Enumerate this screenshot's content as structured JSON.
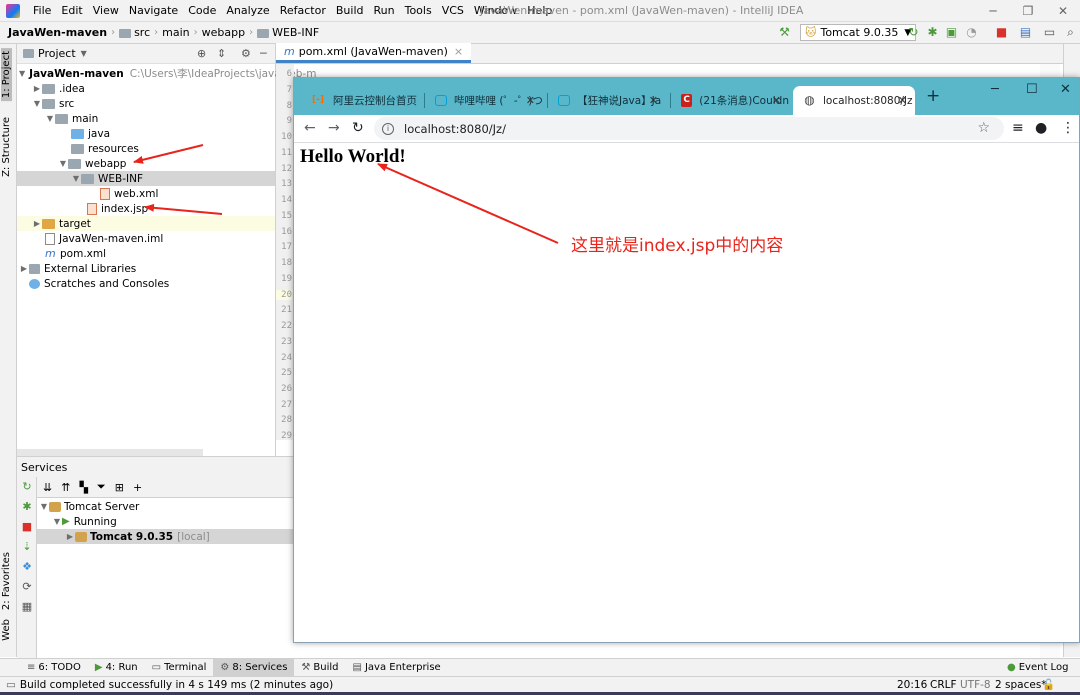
{
  "window": {
    "title": "JavaWen-maven - pom.xml (JavaWen-maven) - IntelliJ IDEA",
    "menu": [
      "File",
      "Edit",
      "View",
      "Navigate",
      "Code",
      "Analyze",
      "Refactor",
      "Build",
      "Run",
      "Tools",
      "VCS",
      "Window",
      "Help"
    ]
  },
  "breadcrumbs": [
    "JavaWen-maven",
    "src",
    "main",
    "webapp",
    "WEB-INF"
  ],
  "run_config": "Tomcat 9.0.35",
  "project_panel": {
    "title": "Project",
    "tree": [
      {
        "label": "JavaWen-maven",
        "extra": "C:\\Users\\李\\IdeaProjects\\javaweb-m",
        "icon": "folder",
        "level": 0
      },
      {
        "label": ".idea",
        "icon": "folder",
        "level": 1
      },
      {
        "label": "src",
        "icon": "folder",
        "level": 1
      },
      {
        "label": "main",
        "icon": "folder",
        "level": 2
      },
      {
        "label": "java",
        "icon": "folder-blue",
        "level": 3
      },
      {
        "label": "resources",
        "icon": "folder",
        "level": 3
      },
      {
        "label": "webapp",
        "icon": "folder",
        "level": 3
      },
      {
        "label": "WEB-INF",
        "icon": "folder",
        "level": 4
      },
      {
        "label": "web.xml",
        "icon": "xml-file",
        "level": 5
      },
      {
        "label": "index.jsp",
        "icon": "jsp-file",
        "level": 4
      },
      {
        "label": "target",
        "icon": "folder-orange",
        "level": 1
      },
      {
        "label": "JavaWen-maven.iml",
        "icon": "iml-file",
        "level": 1
      },
      {
        "label": "pom.xml",
        "icon": "maven-file",
        "level": 1
      },
      {
        "label": "External Libraries",
        "icon": "library",
        "level": 0
      },
      {
        "label": "Scratches and Consoles",
        "icon": "scratch",
        "level": 0
      }
    ]
  },
  "editor": {
    "tab": "pom.xml (JavaWen-maven)",
    "line_numbers": [
      "6",
      "7",
      "8",
      "9",
      "10",
      "11",
      "12",
      "13",
      "14",
      "15",
      "16",
      "17",
      "18",
      "19",
      "20",
      "21",
      "22",
      "23",
      "24",
      "25",
      "26",
      "27",
      "28",
      "29"
    ]
  },
  "left_strip": {
    "project": "1: Project",
    "structure": "Z: Structure",
    "favorites": "2: Favorites",
    "web": "Web"
  },
  "services": {
    "title": "Services",
    "tree": [
      {
        "label": "Tomcat Server",
        "level": 0
      },
      {
        "label": "Running",
        "level": 1
      },
      {
        "label": "Tomcat 9.0.35",
        "extra": "[local]",
        "level": 2
      }
    ]
  },
  "bottom_tools": [
    "6: TODO",
    "4: Run",
    "Terminal",
    "8: Services",
    "Build",
    "Java Enterprise"
  ],
  "event_log": "Event Log",
  "status": {
    "message": "Build completed successfully in 4 s 149 ms (2 minutes ago)",
    "position": "20:16",
    "line_sep": "CRLF",
    "encoding": "UTF-8",
    "indent": "2 spaces*"
  },
  "browser": {
    "tabs": [
      {
        "title": "阿里云控制台首页",
        "icon": "aliyun-icon"
      },
      {
        "title": "哔哩哔哩 (゜-゜)つ",
        "icon": "bilibili-icon"
      },
      {
        "title": "【狂神说Java】Ja",
        "icon": "bilibili-icon"
      },
      {
        "title": "(21条消息)Couldn",
        "icon": "csdn-icon"
      },
      {
        "title": "localhost:8080/Jz",
        "icon": "globe-icon"
      }
    ],
    "url": "localhost:8080/Jz/",
    "page_heading": "Hello World!"
  },
  "annotation": "这里就是index.jsp中的内容"
}
